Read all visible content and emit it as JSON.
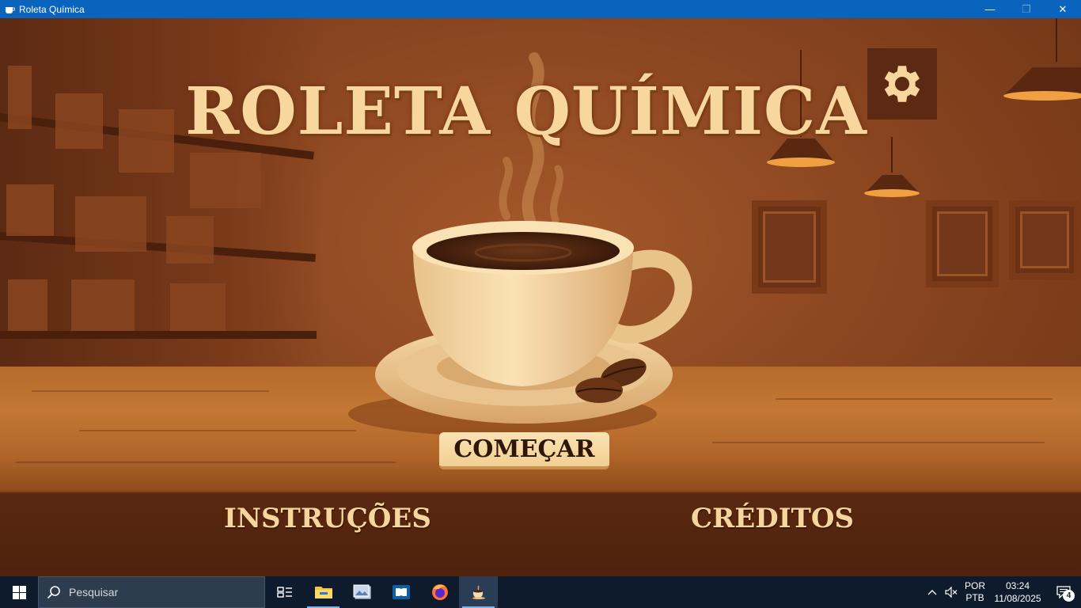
{
  "window": {
    "title": "Roleta Química",
    "minimize": "—",
    "maximize": "❐",
    "close": "✕"
  },
  "game": {
    "title": "ROLETA QUÍMICA",
    "start_button": "COMEÇAR",
    "instructions_link": "INSTRUÇÕES",
    "credits_link": "CRÉDITOS",
    "settings_icon": "gear-icon"
  },
  "taskbar": {
    "search_placeholder": "Pesquisar",
    "apps": [
      {
        "name": "task-view-icon"
      },
      {
        "name": "file-explorer-icon"
      },
      {
        "name": "photos-app-icon"
      },
      {
        "name": "dolby-access-icon"
      },
      {
        "name": "firefox-icon"
      },
      {
        "name": "roleta-quimica-app-icon"
      }
    ],
    "language_top": "POR",
    "language_bottom": "PTB",
    "time": "03:24",
    "date": "11/08/2025",
    "notification_count": "4"
  },
  "colors": {
    "accent": "#0a64bd",
    "title_text": "#f8d79e",
    "button_bg": "#f1cf92",
    "background": "#8b4620"
  }
}
